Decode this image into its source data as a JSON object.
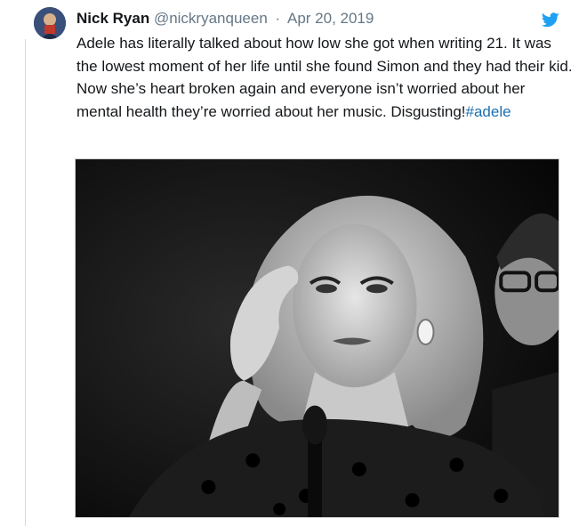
{
  "tweet": {
    "author_name": "Nick Ryan",
    "handle": "@nickryanqueen",
    "separator": "·",
    "date": "Apr 20, 2019",
    "body_text": "Adele has literally talked about how low she got when writing 21. It was the lowest moment of her life until she found Simon and they had their kid. Now she’s heart broken again and everyone isn’t worried about her mental health they’re worried about her music. Disgusting!",
    "hashtag": "#adele",
    "bird_icon": "twitter-bird-icon",
    "avatar_icon": "avatar",
    "photo_description_icon": "tweet-photo"
  },
  "colors": {
    "name": "#14171a",
    "meta": "#657786",
    "hashtag": "#1b6fb1",
    "twitter_blue": "#1da1f2"
  }
}
